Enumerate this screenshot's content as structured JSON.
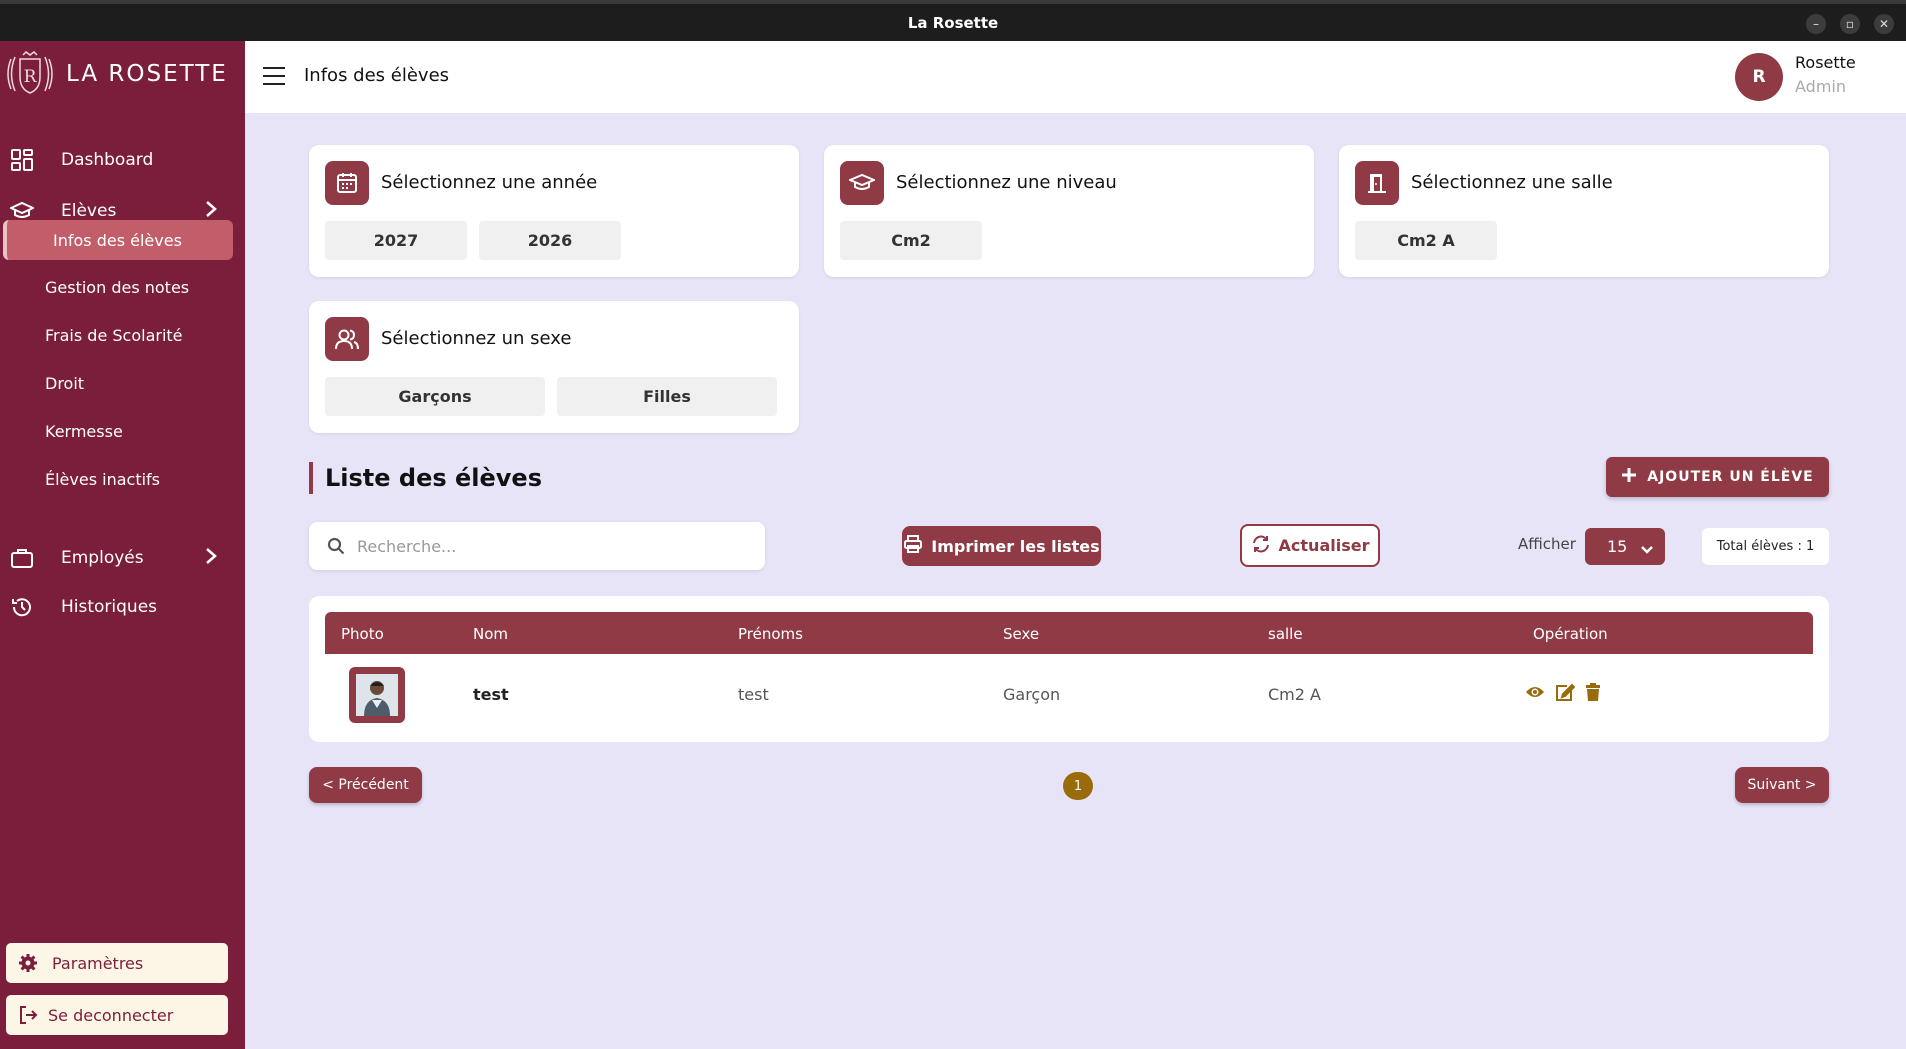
{
  "window": {
    "title": "La Rosette",
    "minimize": "–",
    "restore": "▫",
    "close": "✕"
  },
  "brand": {
    "name": "LA  ROSETTE"
  },
  "sidebar": {
    "items": [
      {
        "label": "Dashboard",
        "icon": "dashboard-icon"
      },
      {
        "label": "Elèves",
        "icon": "graduation-cap-icon"
      },
      {
        "label": "Employés",
        "icon": "briefcase-icon"
      },
      {
        "label": "Historiques",
        "icon": "history-icon"
      }
    ],
    "sub_items": [
      {
        "label": "Infos des élèves",
        "active": true
      },
      {
        "label": "Gestion des notes"
      },
      {
        "label": "Frais de Scolarité"
      },
      {
        "label": "Droit"
      },
      {
        "label": "Kermesse"
      },
      {
        "label": "Élèves inactifs"
      }
    ],
    "settings_label": "Paramètres",
    "logout_label": "Se deconnecter"
  },
  "header": {
    "page_title": "Infos des élèves",
    "avatar_initial": "R",
    "user_name": "Rosette",
    "user_role": "Admin"
  },
  "filters": {
    "year": {
      "title": "Sélectionnez une année",
      "options": [
        "2027",
        "2026"
      ]
    },
    "level": {
      "title": "Sélectionnez une niveau",
      "options": [
        "Cm2"
      ]
    },
    "room": {
      "title": "Sélectionnez une salle",
      "options": [
        "Cm2 A"
      ]
    },
    "sex": {
      "title": "Sélectionnez un sexe",
      "options": [
        "Garçons",
        "Filles"
      ]
    }
  },
  "list": {
    "title": "Liste des élèves",
    "add_button": "AJOUTER UN ÉLÈVE",
    "search_placeholder": "Recherche...",
    "print_button": "Imprimer les listes",
    "refresh_button": "Actualiser",
    "show_label": "Afficher",
    "page_size": "15",
    "total": "Total élèves : 1"
  },
  "table": {
    "headers": [
      "Photo",
      "Nom",
      "Prénoms",
      "Sexe",
      "salle",
      "Opération"
    ],
    "rows": [
      {
        "nom": "test",
        "prenoms": "test",
        "sexe": "Garçon",
        "salle": "Cm2 A"
      }
    ]
  },
  "pagination": {
    "prev": "<  Précédent",
    "current": "1",
    "next": "Suivant  >"
  },
  "colors": {
    "primary": "#8f3a45",
    "sidebar": "#7b1e3c",
    "background": "#e8e4f8",
    "accent_gold": "#9a6b0a"
  }
}
